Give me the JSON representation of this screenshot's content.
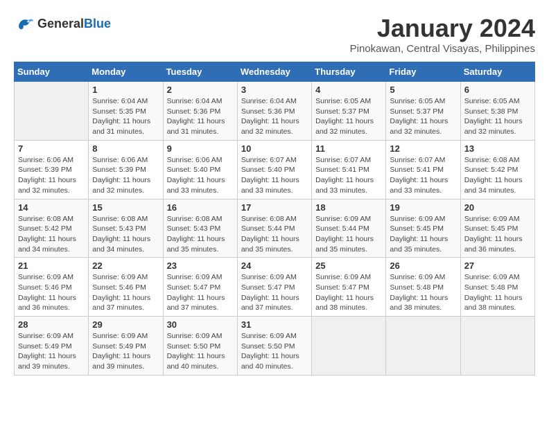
{
  "header": {
    "logo_general": "General",
    "logo_blue": "Blue",
    "month_title": "January 2024",
    "location": "Pinokawan, Central Visayas, Philippines"
  },
  "weekdays": [
    "Sunday",
    "Monday",
    "Tuesday",
    "Wednesday",
    "Thursday",
    "Friday",
    "Saturday"
  ],
  "weeks": [
    [
      {
        "day": "",
        "sunrise": "",
        "sunset": "",
        "daylight": ""
      },
      {
        "day": "1",
        "sunrise": "Sunrise: 6:04 AM",
        "sunset": "Sunset: 5:35 PM",
        "daylight": "Daylight: 11 hours and 31 minutes."
      },
      {
        "day": "2",
        "sunrise": "Sunrise: 6:04 AM",
        "sunset": "Sunset: 5:36 PM",
        "daylight": "Daylight: 11 hours and 31 minutes."
      },
      {
        "day": "3",
        "sunrise": "Sunrise: 6:04 AM",
        "sunset": "Sunset: 5:36 PM",
        "daylight": "Daylight: 11 hours and 32 minutes."
      },
      {
        "day": "4",
        "sunrise": "Sunrise: 6:05 AM",
        "sunset": "Sunset: 5:37 PM",
        "daylight": "Daylight: 11 hours and 32 minutes."
      },
      {
        "day": "5",
        "sunrise": "Sunrise: 6:05 AM",
        "sunset": "Sunset: 5:37 PM",
        "daylight": "Daylight: 11 hours and 32 minutes."
      },
      {
        "day": "6",
        "sunrise": "Sunrise: 6:05 AM",
        "sunset": "Sunset: 5:38 PM",
        "daylight": "Daylight: 11 hours and 32 minutes."
      }
    ],
    [
      {
        "day": "7",
        "sunrise": "Sunrise: 6:06 AM",
        "sunset": "Sunset: 5:39 PM",
        "daylight": "Daylight: 11 hours and 32 minutes."
      },
      {
        "day": "8",
        "sunrise": "Sunrise: 6:06 AM",
        "sunset": "Sunset: 5:39 PM",
        "daylight": "Daylight: 11 hours and 32 minutes."
      },
      {
        "day": "9",
        "sunrise": "Sunrise: 6:06 AM",
        "sunset": "Sunset: 5:40 PM",
        "daylight": "Daylight: 11 hours and 33 minutes."
      },
      {
        "day": "10",
        "sunrise": "Sunrise: 6:07 AM",
        "sunset": "Sunset: 5:40 PM",
        "daylight": "Daylight: 11 hours and 33 minutes."
      },
      {
        "day": "11",
        "sunrise": "Sunrise: 6:07 AM",
        "sunset": "Sunset: 5:41 PM",
        "daylight": "Daylight: 11 hours and 33 minutes."
      },
      {
        "day": "12",
        "sunrise": "Sunrise: 6:07 AM",
        "sunset": "Sunset: 5:41 PM",
        "daylight": "Daylight: 11 hours and 33 minutes."
      },
      {
        "day": "13",
        "sunrise": "Sunrise: 6:08 AM",
        "sunset": "Sunset: 5:42 PM",
        "daylight": "Daylight: 11 hours and 34 minutes."
      }
    ],
    [
      {
        "day": "14",
        "sunrise": "Sunrise: 6:08 AM",
        "sunset": "Sunset: 5:42 PM",
        "daylight": "Daylight: 11 hours and 34 minutes."
      },
      {
        "day": "15",
        "sunrise": "Sunrise: 6:08 AM",
        "sunset": "Sunset: 5:43 PM",
        "daylight": "Daylight: 11 hours and 34 minutes."
      },
      {
        "day": "16",
        "sunrise": "Sunrise: 6:08 AM",
        "sunset": "Sunset: 5:43 PM",
        "daylight": "Daylight: 11 hours and 35 minutes."
      },
      {
        "day": "17",
        "sunrise": "Sunrise: 6:08 AM",
        "sunset": "Sunset: 5:44 PM",
        "daylight": "Daylight: 11 hours and 35 minutes."
      },
      {
        "day": "18",
        "sunrise": "Sunrise: 6:09 AM",
        "sunset": "Sunset: 5:44 PM",
        "daylight": "Daylight: 11 hours and 35 minutes."
      },
      {
        "day": "19",
        "sunrise": "Sunrise: 6:09 AM",
        "sunset": "Sunset: 5:45 PM",
        "daylight": "Daylight: 11 hours and 35 minutes."
      },
      {
        "day": "20",
        "sunrise": "Sunrise: 6:09 AM",
        "sunset": "Sunset: 5:45 PM",
        "daylight": "Daylight: 11 hours and 36 minutes."
      }
    ],
    [
      {
        "day": "21",
        "sunrise": "Sunrise: 6:09 AM",
        "sunset": "Sunset: 5:46 PM",
        "daylight": "Daylight: 11 hours and 36 minutes."
      },
      {
        "day": "22",
        "sunrise": "Sunrise: 6:09 AM",
        "sunset": "Sunset: 5:46 PM",
        "daylight": "Daylight: 11 hours and 37 minutes."
      },
      {
        "day": "23",
        "sunrise": "Sunrise: 6:09 AM",
        "sunset": "Sunset: 5:47 PM",
        "daylight": "Daylight: 11 hours and 37 minutes."
      },
      {
        "day": "24",
        "sunrise": "Sunrise: 6:09 AM",
        "sunset": "Sunset: 5:47 PM",
        "daylight": "Daylight: 11 hours and 37 minutes."
      },
      {
        "day": "25",
        "sunrise": "Sunrise: 6:09 AM",
        "sunset": "Sunset: 5:47 PM",
        "daylight": "Daylight: 11 hours and 38 minutes."
      },
      {
        "day": "26",
        "sunrise": "Sunrise: 6:09 AM",
        "sunset": "Sunset: 5:48 PM",
        "daylight": "Daylight: 11 hours and 38 minutes."
      },
      {
        "day": "27",
        "sunrise": "Sunrise: 6:09 AM",
        "sunset": "Sunset: 5:48 PM",
        "daylight": "Daylight: 11 hours and 38 minutes."
      }
    ],
    [
      {
        "day": "28",
        "sunrise": "Sunrise: 6:09 AM",
        "sunset": "Sunset: 5:49 PM",
        "daylight": "Daylight: 11 hours and 39 minutes."
      },
      {
        "day": "29",
        "sunrise": "Sunrise: 6:09 AM",
        "sunset": "Sunset: 5:49 PM",
        "daylight": "Daylight: 11 hours and 39 minutes."
      },
      {
        "day": "30",
        "sunrise": "Sunrise: 6:09 AM",
        "sunset": "Sunset: 5:50 PM",
        "daylight": "Daylight: 11 hours and 40 minutes."
      },
      {
        "day": "31",
        "sunrise": "Sunrise: 6:09 AM",
        "sunset": "Sunset: 5:50 PM",
        "daylight": "Daylight: 11 hours and 40 minutes."
      },
      {
        "day": "",
        "sunrise": "",
        "sunset": "",
        "daylight": ""
      },
      {
        "day": "",
        "sunrise": "",
        "sunset": "",
        "daylight": ""
      },
      {
        "day": "",
        "sunrise": "",
        "sunset": "",
        "daylight": ""
      }
    ]
  ]
}
